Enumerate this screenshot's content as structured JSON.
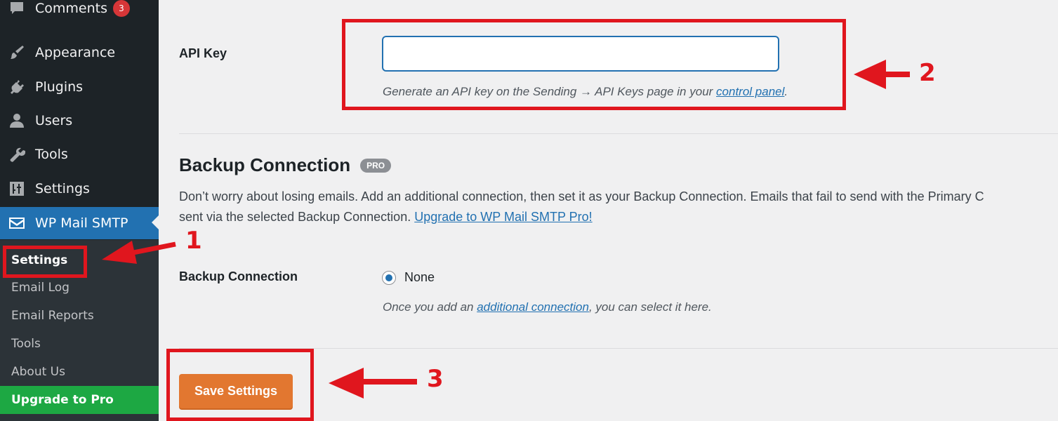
{
  "sidebar": {
    "items": [
      {
        "label": "Comments",
        "icon": "comment-bubble-icon",
        "badge": "3"
      },
      {
        "label": "Appearance",
        "icon": "paintbrush-icon"
      },
      {
        "label": "Plugins",
        "icon": "plug-icon"
      },
      {
        "label": "Users",
        "icon": "user-icon"
      },
      {
        "label": "Tools",
        "icon": "wrench-icon"
      },
      {
        "label": "Settings",
        "icon": "settings-sliders-icon"
      },
      {
        "label": "WP Mail SMTP",
        "icon": "mail-icon",
        "active": true
      }
    ],
    "submenu": [
      {
        "label": "Settings",
        "current": true
      },
      {
        "label": "Email Log"
      },
      {
        "label": "Email Reports"
      },
      {
        "label": "Tools"
      },
      {
        "label": "About Us"
      },
      {
        "label": "Upgrade to Pro"
      }
    ]
  },
  "api_key": {
    "label": "API Key",
    "value": "",
    "placeholder": "",
    "description_prefix": "Generate an API key on the Sending → API Keys page in your ",
    "description_link": "control panel",
    "description_suffix": "."
  },
  "backup": {
    "title": "Backup Connection",
    "badge": "PRO",
    "intro_line1": "Don’t worry about losing emails. Add an additional connection, then set it as your Backup Connection. Emails that fail to send with the Primary C",
    "intro_line2_prefix": "sent via the selected Backup Connection. ",
    "intro_link": "Upgrade to WP Mail SMTP Pro!",
    "field_label": "Backup Connection",
    "option_label": "None",
    "option_selected": true,
    "help_prefix": "Once you add an ",
    "help_link": "additional connection",
    "help_suffix": ", you can select it here."
  },
  "save_button": "Save Settings",
  "annotations": {
    "step1": "1",
    "step2": "2",
    "step3": "3",
    "color": "#e0161e"
  },
  "colors": {
    "sidebar_bg": "#1d2327",
    "active_blue": "#2271b1",
    "upgrade_green": "#1da843",
    "save_orange": "#e27730"
  }
}
